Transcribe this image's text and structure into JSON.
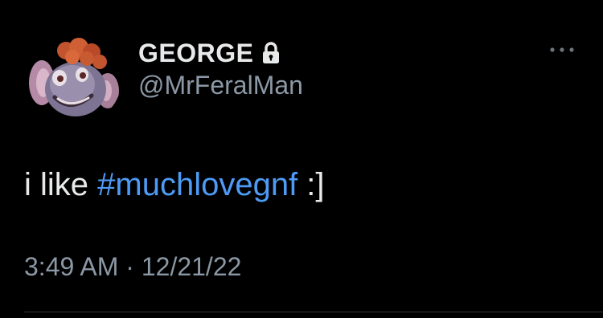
{
  "author": {
    "display_name": "GEORGE",
    "handle": "@MrFeralMan",
    "protected": true,
    "avatar_icon": "clown-character-avatar",
    "lock_icon": "lock-icon"
  },
  "tweet": {
    "text_before": "i like ",
    "hashtag": "#muchlovegnf",
    "text_after": " :]"
  },
  "meta": {
    "time": "3:49 AM",
    "separator": " · ",
    "date": "12/21/22"
  },
  "colors": {
    "background": "#000000",
    "primary_text": "#e7e9ea",
    "secondary_text": "#8b98a5",
    "hashtag": "#4e9bf5",
    "divider": "#2f3336"
  },
  "icons": {
    "more": "more-horizontal-icon"
  }
}
